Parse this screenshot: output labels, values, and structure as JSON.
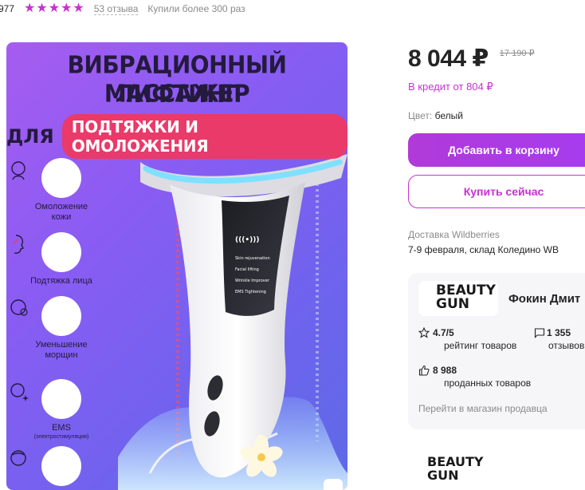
{
  "meta": {
    "article": "977",
    "rating_stars": 5,
    "reviews_link": "53 отзыва",
    "bought": "Купили более 300 раз"
  },
  "image": {
    "headline_line1": "ВИБРАЦИОННЫЙ ЛИФТИНГ",
    "headline_line2": "МАССАЖЕР",
    "headline_line3_left": "ДЛЯ",
    "headline_line3_pill": "ПОДТЯЖКИ И ОМОЛОЖЕНИЯ",
    "benefits": [
      {
        "label": "Омоложение\nкожи",
        "sublabel": ""
      },
      {
        "label": "Подтяжка лица",
        "sublabel": ""
      },
      {
        "label": "Уменьшение\nморщин",
        "sublabel": ""
      },
      {
        "label": "EMS",
        "sublabel": "(электростимуляция)"
      },
      {
        "label": "",
        "sublabel": ""
      }
    ],
    "device_modes": [
      "Skin rejuvenation",
      "Facial lifting",
      "Wrinkle Improver",
      "EMS Tightening"
    ],
    "colors": {
      "background_start": "#a65cf0",
      "background_end": "#5d6ae6",
      "pill": "#e93a6a",
      "headline": "#241a3e"
    }
  },
  "pricing": {
    "price": "8 044 ₽",
    "old_price": "17 190 ₽",
    "credit": "В кредит от 804 ₽"
  },
  "color_option": {
    "key": "Цвет:",
    "value": "белый"
  },
  "buttons": {
    "add_to_cart": "Добавить в корзину",
    "buy_now": "Купить сейчас"
  },
  "delivery": {
    "label": "Доставка Wildberries",
    "value": "7-9 февраля, склад Коледино WB"
  },
  "seller": {
    "logo_text": "BEAUTY\nGUN",
    "name": "Фокин Дмит",
    "rating": "4.7/5",
    "rating_caption": "рейтинг товаров",
    "reviews": "1 355",
    "reviews_caption": "отзывов",
    "sold": "8 988",
    "sold_caption": "проданных товаров",
    "store_link": "Перейти в магазин продавца"
  },
  "brand_block": {
    "logo_text": "BEAUTY\nGUN"
  },
  "accent_color": "#c731d1",
  "button_color": "#a53cf0"
}
